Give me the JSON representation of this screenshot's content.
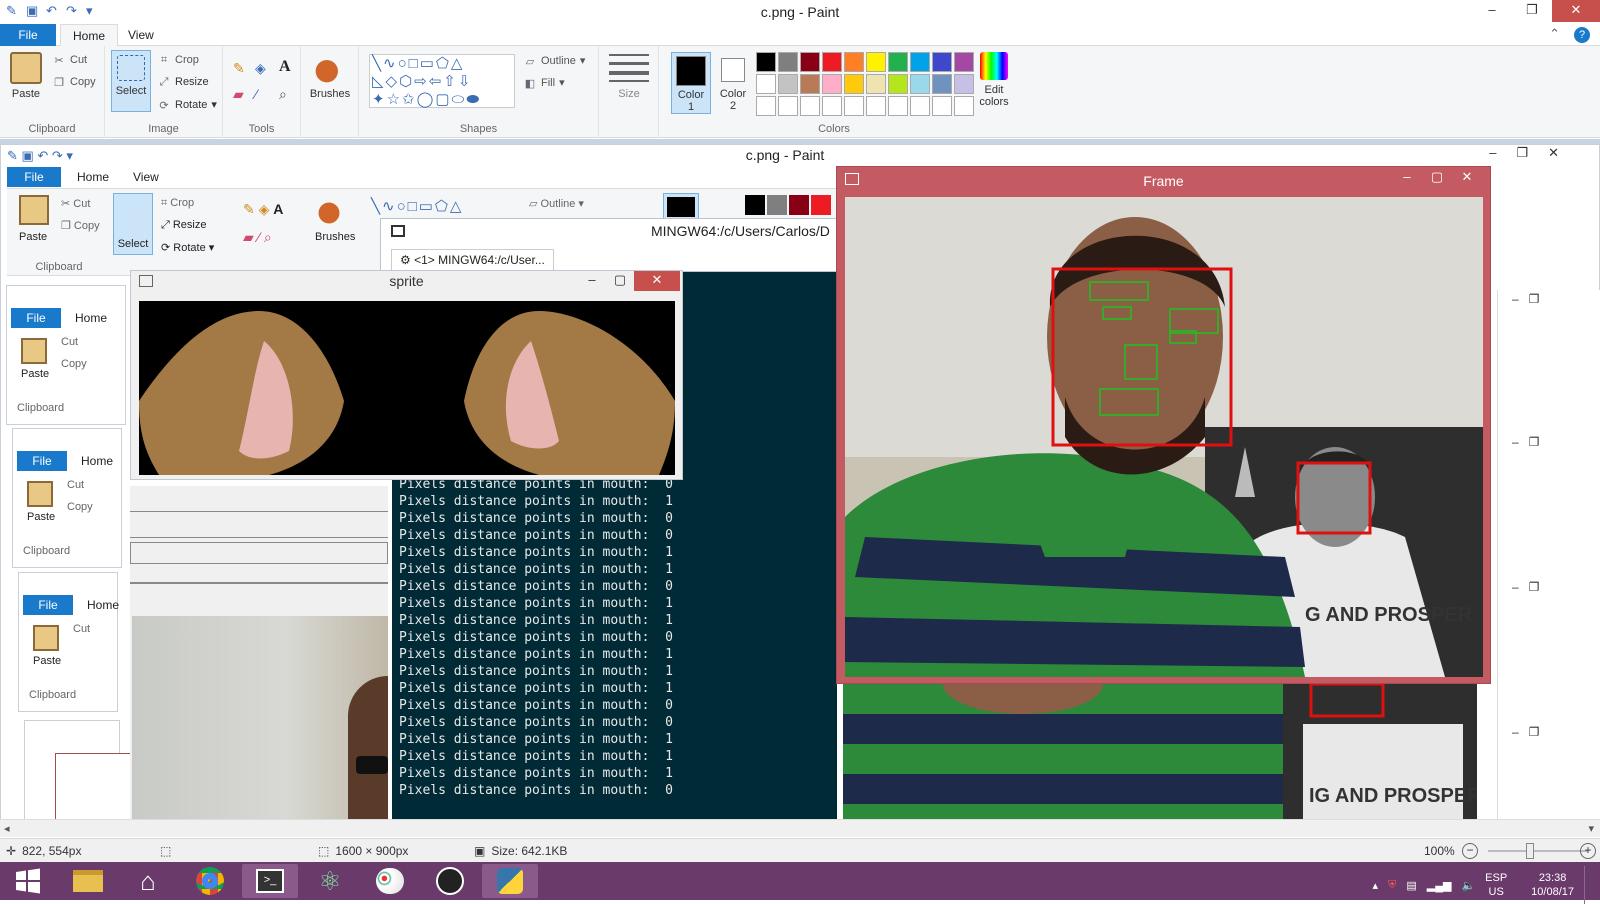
{
  "main": {
    "title": "c.png - Paint",
    "tabs": {
      "file": "File",
      "home": "Home",
      "view": "View"
    },
    "clipboard": {
      "paste": "Paste",
      "cut": "Cut",
      "copy": "Copy",
      "label": "Clipboard"
    },
    "image": {
      "select": "Select",
      "crop": "Crop",
      "resize": "Resize",
      "rotate": "Rotate",
      "label": "Image"
    },
    "tools": {
      "label": "Tools"
    },
    "brushes": {
      "label": "Brushes"
    },
    "shapes": {
      "outline": "Outline",
      "fill": "Fill",
      "label": "Shapes"
    },
    "size": {
      "label": "Size"
    },
    "colors": {
      "color1": "Color 1",
      "color2": "Color 2",
      "edit": "Edit colors",
      "label": "Colors",
      "palette": [
        "#000000",
        "#7f7f7f",
        "#880015",
        "#ed1c24",
        "#ff7f27",
        "#fff200",
        "#22b14c",
        "#00a2e8",
        "#3f48cc",
        "#a349a4",
        "#ffffff",
        "#c3c3c3",
        "#b97a57",
        "#ffaec9",
        "#ffc90e",
        "#efe4b0",
        "#b5e61d",
        "#99d9ea",
        "#7092be",
        "#c8bfe7",
        "#ffffff",
        "#ffffff",
        "#ffffff",
        "#ffffff",
        "#ffffff",
        "#ffffff",
        "#ffffff",
        "#ffffff",
        "#ffffff",
        "#ffffff"
      ]
    }
  },
  "nested": {
    "title": "c.png - Paint",
    "file": "File",
    "home": "Home",
    "view": "View",
    "paste": "Paste",
    "cut": "Cut",
    "copy": "Copy",
    "select": "Select",
    "crop": "Crop",
    "resize": "Resize",
    "rotate": "Rotate",
    "brushes": "Brushes",
    "outline": "Outline",
    "clipboard": "Clipboard"
  },
  "terminal": {
    "title": "MINGW64:/c/Users/Carlos/D",
    "tab": "<1> MINGW64:/c/User...",
    "lines": [
      "Pixels distance points in mouth:  0",
      "Pixels distance points in mouth:  1",
      "Pixels distance points in mouth:  0",
      "Pixels distance points in mouth:  0",
      "Pixels distance points in mouth:  1",
      "Pixels distance points in mouth:  1",
      "Pixels distance points in mouth:  0",
      "Pixels distance points in mouth:  1",
      "Pixels distance points in mouth:  1",
      "Pixels distance points in mouth:  0",
      "Pixels distance points in mouth:  1",
      "Pixels distance points in mouth:  1",
      "Pixels distance points in mouth:  1",
      "Pixels distance points in mouth:  0",
      "Pixels distance points in mouth:  0",
      "Pixels distance points in mouth:  1",
      "Pixels distance points in mouth:  1",
      "Pixels distance points in mouth:  1",
      "Pixels distance points in mouth:  0"
    ]
  },
  "sprite": {
    "title": "sprite"
  },
  "frame": {
    "title": "Frame",
    "poster_text": "G AND PROSPER",
    "poster_text2": "IG AND PROSPER"
  },
  "status": {
    "cursor": "822, 554px",
    "dimensions": "1600 × 900px",
    "size": "Size: 642.1KB",
    "zoom": "100%"
  },
  "tray": {
    "lang": "ESP",
    "locale": "US",
    "time": "23:38",
    "date": "10/08/17"
  }
}
